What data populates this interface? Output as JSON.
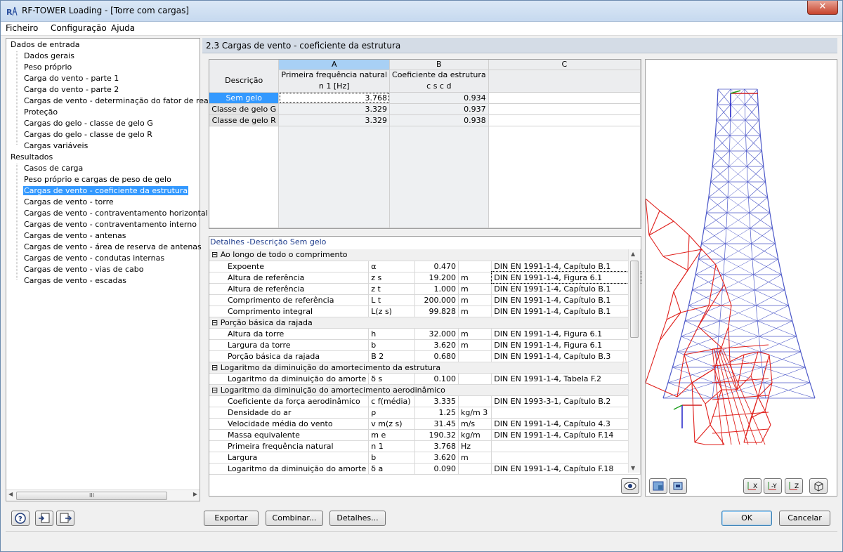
{
  "window": {
    "title": "RF-TOWER Loading - [Torre com cargas]",
    "close": "✕"
  },
  "menu": [
    "Ficheiro",
    "Configuração",
    "Ajuda"
  ],
  "tree": {
    "input_root": "Dados de entrada",
    "input_items": [
      "Dados gerais",
      "Peso próprio",
      "Carga do vento - parte 1",
      "Carga do vento - parte 2",
      "Cargas de vento - determinação do fator de reação",
      "Proteção",
      "Cargas do gelo - classe de gelo G",
      "Cargas do gelo - classe de gelo R",
      "Cargas variáveis"
    ],
    "results_root": "Resultados",
    "results_items": [
      "Casos de carga",
      "Peso próprio e cargas de peso de gelo",
      "Cargas de vento - coeficiente da estrutura",
      "Cargas de vento - torre",
      "Cargas de vento - contraventamento horizontal",
      "Cargas de vento - contraventamento interno",
      "Cargas de vento - antenas",
      "Cargas de vento - área de reserva de antenas",
      "Cargas de vento - condutas internas",
      "Cargas de vento - vias de cabo",
      "Cargas de vento - escadas"
    ],
    "selected": "Cargas de vento - coeficiente da estrutura",
    "scroll_grip": "III"
  },
  "section_title": "2.3 Cargas de vento - coeficiente da estrutura",
  "grid": {
    "col_letters": [
      "A",
      "B",
      "C"
    ],
    "desc_header": "Descrição",
    "col_a_line1": "Primeira frequência natural",
    "col_a_line2": "n 1 [Hz]",
    "col_b_line1": "Coeficiente da estrutura",
    "col_b_line2": "c s c d",
    "rows": [
      {
        "label": "Sem gelo",
        "a": "3.768",
        "b": "0.934"
      },
      {
        "label": "Classe de gelo G",
        "a": "3.329",
        "b": "0.937"
      },
      {
        "label": "Classe de gelo R",
        "a": "3.329",
        "b": "0.938"
      }
    ]
  },
  "details": {
    "title": "Detalhes  -Descrição Sem gelo",
    "groups": [
      {
        "name": "Ao longo de todo o comprimento",
        "rows": [
          {
            "desc": "Expoente",
            "sym": "α",
            "val": "0.470",
            "unit": "",
            "ref": "DIN EN 1991-1-4, Capítulo B.1"
          },
          {
            "desc": "Altura de referência",
            "sym": "z s",
            "val": "19.200",
            "unit": "m",
            "ref": "DIN EN 1991-1-4, Figura 6.1"
          },
          {
            "desc": "Altura de referência",
            "sym": "z t",
            "val": "1.000",
            "unit": "m",
            "ref": "DIN EN 1991-1-4, Capítulo B.1"
          },
          {
            "desc": "Comprimento de referência",
            "sym": "L t",
            "val": "200.000",
            "unit": "m",
            "ref": "DIN EN 1991-1-4, Capítulo B.1"
          },
          {
            "desc": "Comprimento integral",
            "sym": "L(z s)",
            "val": "99.828",
            "unit": "m",
            "ref": "DIN EN 1991-1-4, Capítulo B.1"
          }
        ]
      },
      {
        "name": "Porção básica da rajada",
        "rows": [
          {
            "desc": "Altura da torre",
            "sym": "h",
            "val": "32.000",
            "unit": "m",
            "ref": "DIN EN 1991-1-4, Figura 6.1"
          },
          {
            "desc": "Largura da torre",
            "sym": "b",
            "val": "3.620",
            "unit": "m",
            "ref": "DIN EN 1991-1-4, Figura 6.1"
          },
          {
            "desc": "Porção básica da rajada",
            "sym": "B 2",
            "val": "0.680",
            "unit": "",
            "ref": "DIN EN 1991-1-4, Capítulo B.3"
          }
        ]
      },
      {
        "name": "Logaritmo da diminuição do amortecimento da estrutura",
        "rows": [
          {
            "desc": "Logaritmo da diminuição do amorte",
            "sym": "δ s",
            "val": "0.100",
            "unit": "",
            "ref": "DIN EN 1991-1-4, Tabela F.2"
          }
        ]
      },
      {
        "name": "Logaritmo da diminuição do amortecimento aerodinâmico",
        "rows": [
          {
            "desc": "Coeficiente da força aerodinâmico",
            "sym": "c f(média)",
            "val": "3.335",
            "unit": "",
            "ref": "DIN EN 1993-3-1, Capítulo B.2"
          },
          {
            "desc": "Densidade do ar",
            "sym": "ρ",
            "val": "1.25",
            "unit": "kg/m 3",
            "ref": ""
          },
          {
            "desc": "Velocidade média do vento",
            "sym": "v m(z s)",
            "val": "31.45",
            "unit": "m/s",
            "ref": "DIN EN 1991-1-4, Capítulo 4.3"
          },
          {
            "desc": "Massa equivalente",
            "sym": "m e",
            "val": "190.32",
            "unit": "kg/m",
            "ref": "DIN EN 1991-1-4, Capítulo F.14"
          },
          {
            "desc": "Primeira frequência natural",
            "sym": "n 1",
            "val": "3.768",
            "unit": "Hz",
            "ref": ""
          },
          {
            "desc": "Largura",
            "sym": "b",
            "val": "3.620",
            "unit": "m",
            "ref": ""
          },
          {
            "desc": "Logaritmo da diminuição do amorte",
            "sym": "δ a",
            "val": "0.090",
            "unit": "",
            "ref": "DIN EN 1991-1-4, Capítulo F.18"
          }
        ]
      }
    ]
  },
  "buttons": {
    "export": "Exportar",
    "combine": "Combinar...",
    "details": "Detalhes...",
    "ok": "OK",
    "cancel": "Cancelar"
  },
  "colors": {
    "selection": "#3399ff",
    "tower_blue": "#4b57c8",
    "tower_red": "#e0201c"
  }
}
